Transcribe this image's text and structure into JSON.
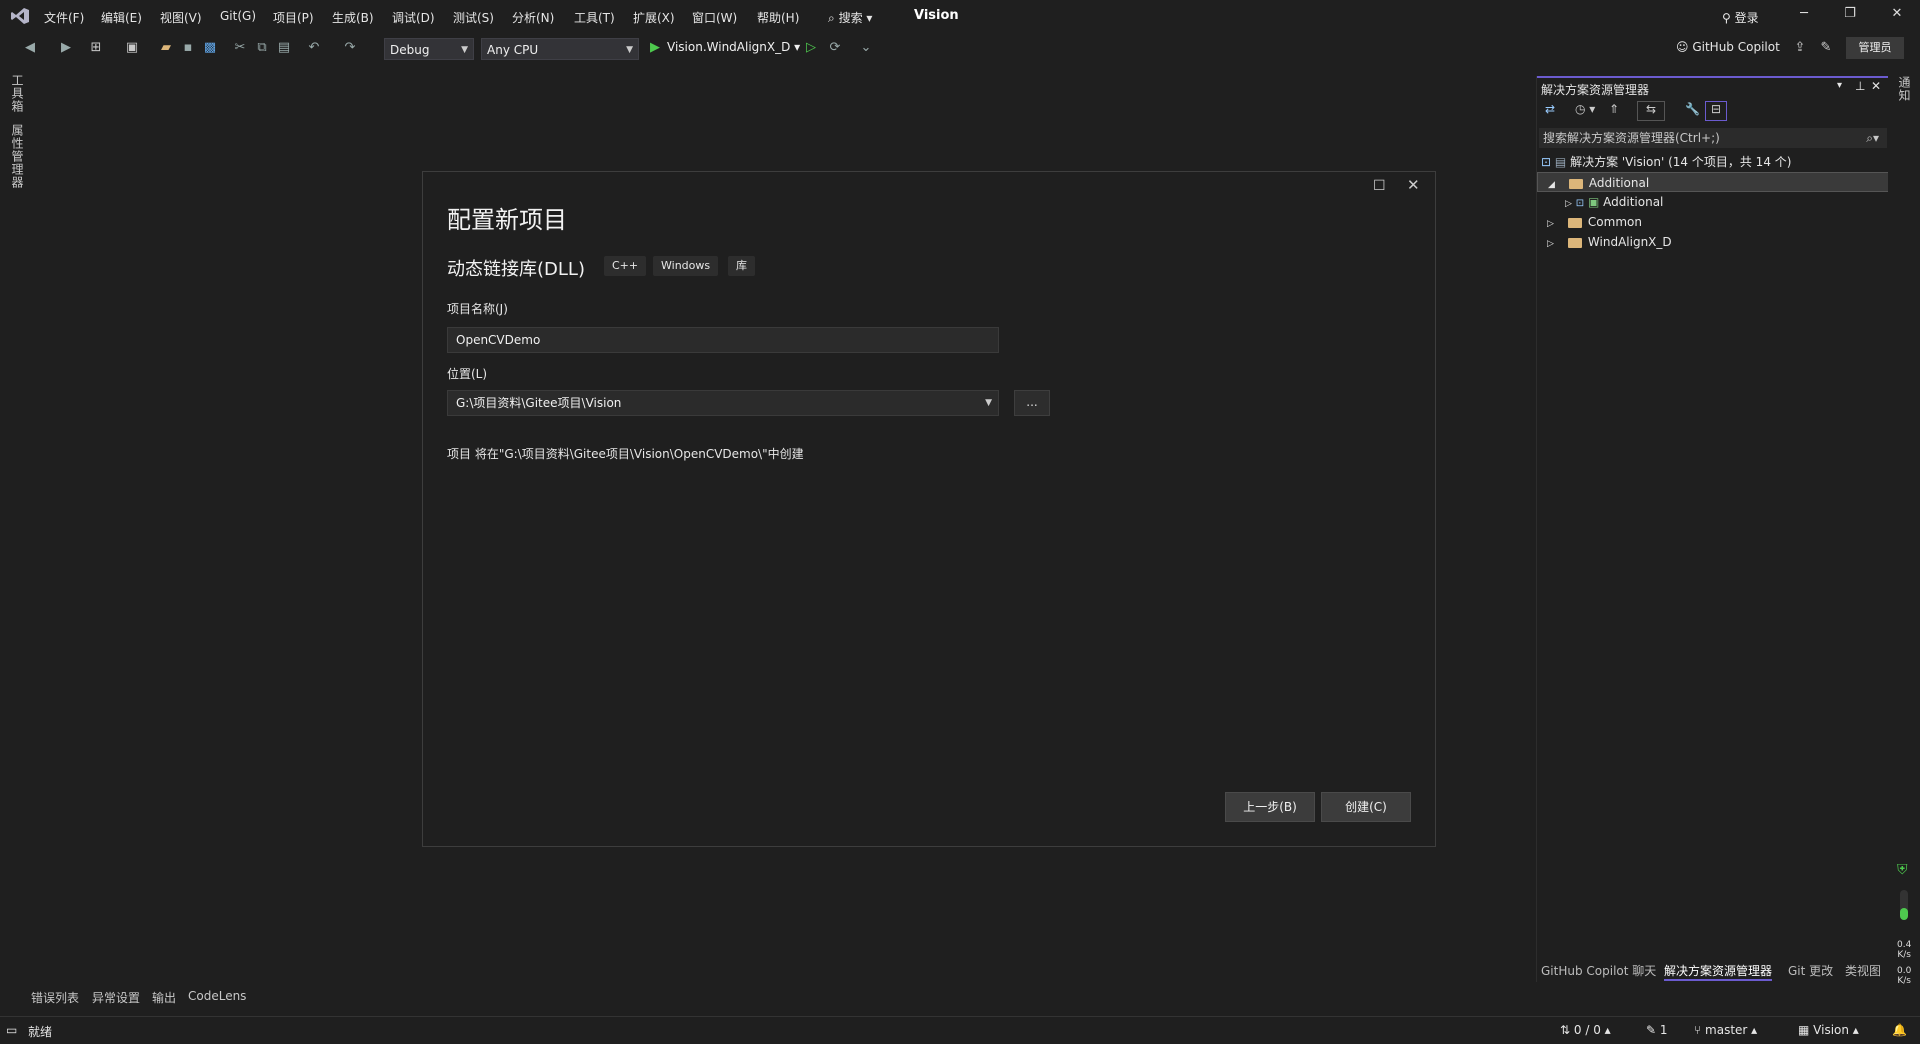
{
  "menubar": {
    "items": [
      "文件(F)",
      "编辑(E)",
      "视图(V)",
      "Git(G)",
      "项目(P)",
      "生成(B)",
      "调试(D)",
      "测试(S)",
      "分析(N)",
      "工具(T)",
      "扩展(X)",
      "窗口(W)",
      "帮助(H)"
    ],
    "search_label": "搜索",
    "app_title": "Vision",
    "login_label": "登录"
  },
  "toolbar": {
    "config": "Debug",
    "platform": "Any CPU",
    "startup_project": "Vision.WindAlignX_D",
    "copilot_label": "GitHub Copilot",
    "admin_label": "管理员"
  },
  "left_rail": {
    "toolbox": "工具箱",
    "property_manager": "属性管理器"
  },
  "dialog": {
    "title": "配置新项目",
    "subtitle": "动态链接库(DLL)",
    "tags": [
      "C++",
      "Windows",
      "库"
    ],
    "name_label": "项目名称(J)",
    "name_value": "OpenCVDemo",
    "location_label": "位置(L)",
    "location_value": "G:\\项目资料\\Gitee项目\\Vision",
    "browse_label": "...",
    "info": "项目 将在\"G:\\项目资料\\Gitee项目\\Vision\\OpenCVDemo\\\"中创建",
    "back_button": "上一步(B)",
    "create_button": "创建(C)"
  },
  "solution_explorer": {
    "title": "解决方案资源管理器",
    "search_placeholder": "搜索解决方案资源管理器(Ctrl+;)",
    "solution_label": "解决方案 'Vision' (14 个项目，共 14 个)",
    "tree": [
      {
        "label": "Additional",
        "selected": true
      },
      {
        "label": "Additional",
        "selected": false
      },
      {
        "label": "Common",
        "selected": false
      },
      {
        "label": "WindAlignX_D",
        "selected": false
      }
    ],
    "bottom_tabs": [
      "GitHub Copilot 聊天",
      "解决方案资源管理器",
      "Git 更改",
      "类视图"
    ]
  },
  "right_rail": {
    "notifications": "通知",
    "up_rate": "0.4",
    "up_unit": "K/s",
    "down_rate": "0.0",
    "down_unit": "K/s"
  },
  "bottom_tool_tabs": [
    "错误列表",
    "异常设置",
    "输出",
    "CodeLens"
  ],
  "statusbar": {
    "ready": "就绪",
    "changes": "0 / 0",
    "pending": "1",
    "branch": "master",
    "repo": "Vision"
  },
  "colors": {
    "accent": "#6b5bcf",
    "folder": "#dcb67a",
    "run_green": "#4ec94e"
  }
}
